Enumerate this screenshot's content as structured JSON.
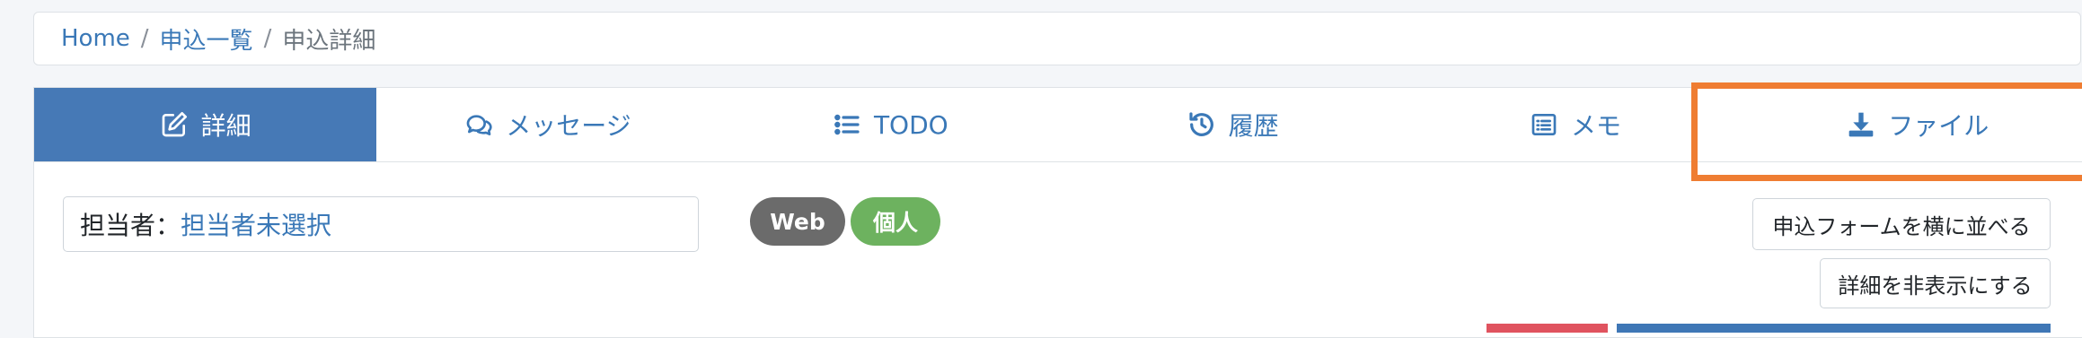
{
  "breadcrumb": {
    "home": "Home",
    "list": "申込一覧",
    "current": "申込詳細",
    "separator": "/"
  },
  "tabs": [
    {
      "label": "詳細",
      "icon": "edit-icon",
      "active": true
    },
    {
      "label": "メッセージ",
      "icon": "comments-icon",
      "active": false
    },
    {
      "label": "TODO",
      "icon": "list-icon",
      "active": false
    },
    {
      "label": "履歴",
      "icon": "history-icon",
      "active": false
    },
    {
      "label": "メモ",
      "icon": "memo-icon",
      "active": false
    },
    {
      "label": "ファイル",
      "icon": "download-icon",
      "active": false
    }
  ],
  "assignee": {
    "label": "担当者：",
    "value": "担当者未選択"
  },
  "badges": {
    "channel": "Web",
    "type": "個人"
  },
  "buttons": {
    "side_by_side": "申込フォームを横に並べる",
    "hide_details": "詳細を非表示にする"
  },
  "colors": {
    "accent": "#4679b6",
    "link": "#3a78b7",
    "badge_web": "#6b6b6b",
    "badge_personal": "#6db25f",
    "highlight": "#ef7d32"
  }
}
